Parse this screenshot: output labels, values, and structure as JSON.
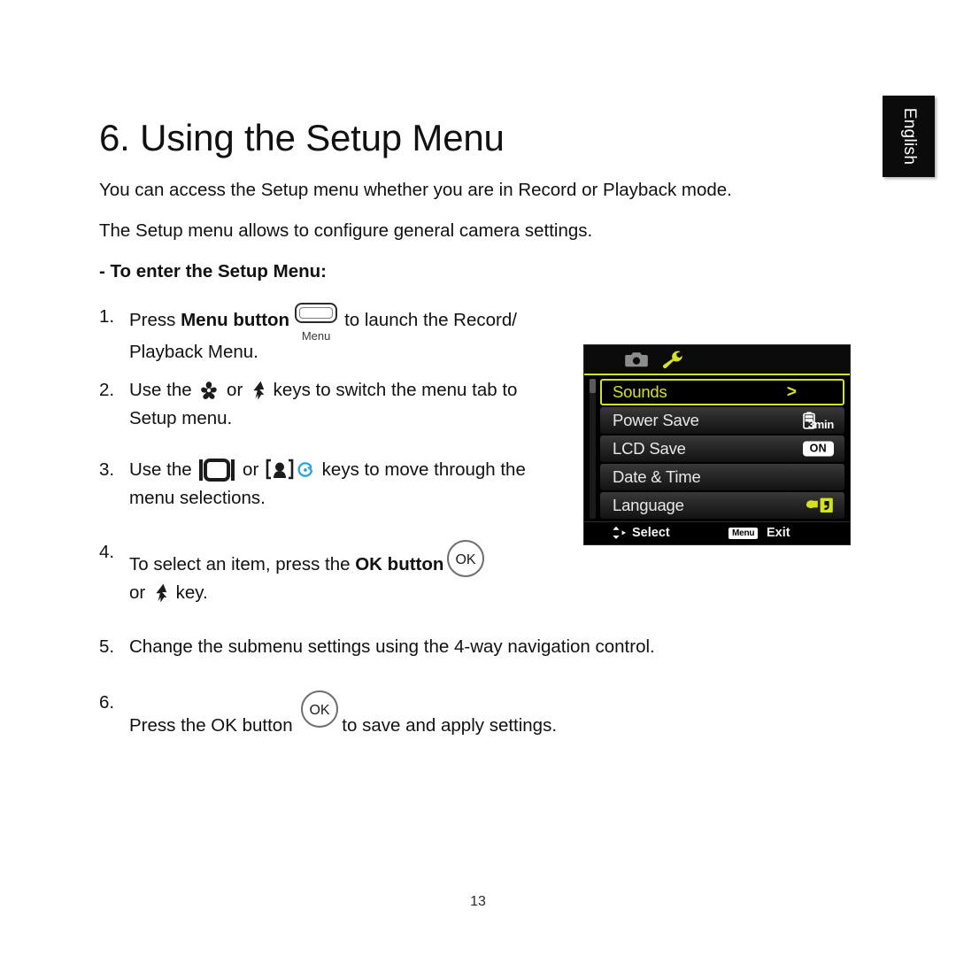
{
  "document": {
    "language_tab": "English",
    "page_number": "13",
    "title": "6. Using the Setup Menu",
    "intro": [
      "You can access the Setup menu whether you are in Record or Playback mode.",
      "The Setup menu allows to configure general camera settings."
    ],
    "section_heading": "- To enter the Setup Menu:",
    "steps": [
      {
        "number": "1.",
        "line1_a": "Press ",
        "line1_bold": "Menu button",
        "icon": "menu-button-icon",
        "icon_caption": "Menu",
        "line1_b": "to launch the Record/",
        "line2": "Playback Menu."
      },
      {
        "number": "2.",
        "line1_a": "Use the ",
        "icon_a": "macro-flower-icon",
        "line1_b": " or ",
        "icon_b": "flash-bolt-icon",
        "line1_c": " keys to switch the menu tab to",
        "line2": "Setup menu."
      },
      {
        "number": "3.",
        "line1_a": "Use the ",
        "icon_a": "display-screen-icon",
        "line1_b": " or ",
        "icon_b": "portrait-bracket-icon",
        "icon_c": "self-timer-icon",
        "line1_c": " keys to move through the",
        "line2": "menu selections."
      },
      {
        "number": "4.",
        "line1_a": "To select an item, press the ",
        "line1_bold": "OK button",
        "icon_a": "ok-button-icon",
        "line2_a": "or ",
        "icon_b": "flash-bolt-icon",
        "line2_b": " key."
      },
      {
        "number": "5.",
        "line1": "Change the submenu settings using the 4-way navigation control."
      },
      {
        "number": "6.",
        "line1_a": "Press the OK button ",
        "icon_a": "ok-button-icon",
        "line1_b": "to save and apply settings."
      }
    ]
  },
  "lcd": {
    "tabs": [
      {
        "name": "record-tab",
        "icon": "camera-icon",
        "active": false
      },
      {
        "name": "setup-tab",
        "icon": "wrench-icon",
        "active": true
      }
    ],
    "rows": [
      {
        "label": "Sounds",
        "value_type": "chevron",
        "value": ">",
        "selected": true
      },
      {
        "label": "Power Save",
        "value_type": "battery",
        "value": "3min",
        "selected": false
      },
      {
        "label": "LCD Save",
        "value_type": "pill",
        "value": "ON",
        "selected": false
      },
      {
        "label": "Date & Time",
        "value_type": "none",
        "value": "",
        "selected": false
      },
      {
        "label": "Language",
        "value_type": "bubble",
        "value": "",
        "selected": false
      }
    ],
    "status": {
      "select_label": "Select",
      "menu_chip": "Menu",
      "exit_label": "Exit"
    },
    "colors": {
      "accent": "#d6e024",
      "background": "#000000",
      "row_text": "#e8e8e8"
    }
  }
}
